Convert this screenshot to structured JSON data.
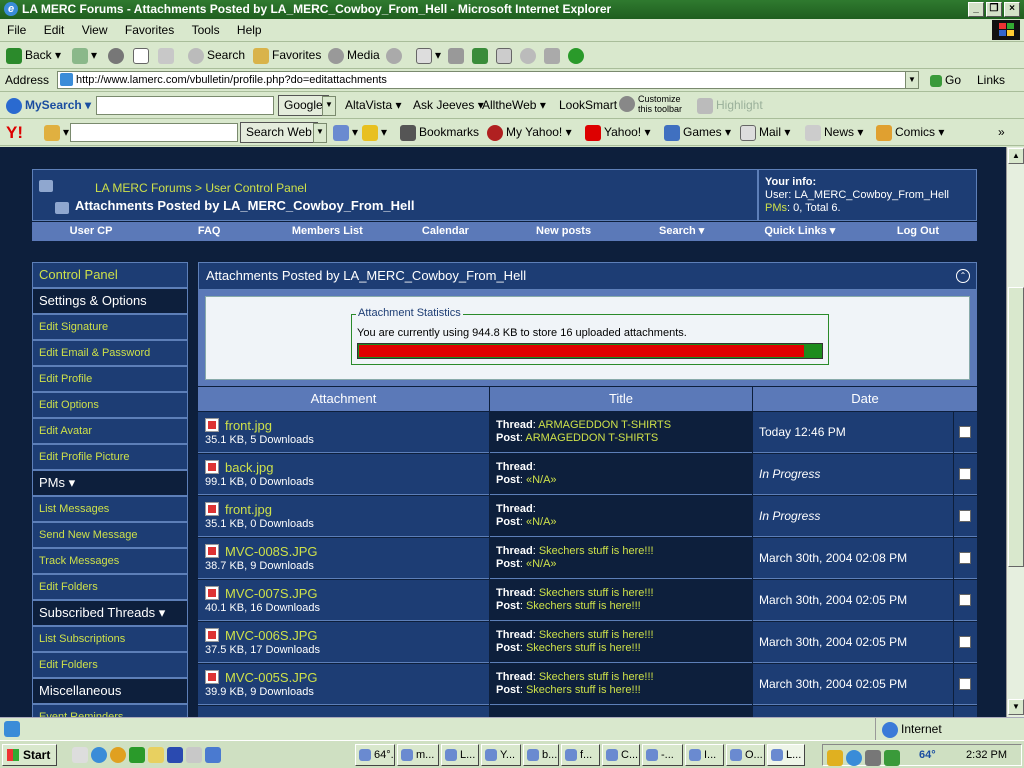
{
  "window": {
    "title": "LA MERC Forums - Attachments Posted by LA_MERC_Cowboy_From_Hell - Microsoft Internet Explorer",
    "controls": [
      "_",
      "❐",
      "×"
    ]
  },
  "menu": [
    "File",
    "Edit",
    "View",
    "Favorites",
    "Tools",
    "Help"
  ],
  "toolbar": {
    "back": "Back",
    "search": "Search",
    "favorites": "Favorites",
    "media": "Media"
  },
  "address": {
    "label": "Address",
    "url": "http://www.lamerc.com/vbulletin/profile.php?do=editattachments",
    "go": "Go",
    "links": "Links"
  },
  "mysearch": {
    "brand": "MySearch",
    "items": [
      "Google",
      "AltaVista",
      "Ask Jeeves",
      "AlltheWeb",
      "LookSmart"
    ],
    "customize_line1": "Customize",
    "customize_line2": "this toolbar",
    "highlight": "Highlight"
  },
  "yahoo": {
    "logo": "Y!",
    "search_web": "Search Web",
    "items": [
      "Bookmarks",
      "My Yahoo!",
      "Yahoo!",
      "Games",
      "Mail",
      "News",
      "Comics"
    ]
  },
  "forum": {
    "breadcrumb_site": "LA MERC Forums",
    "breadcrumb_sep": ">",
    "breadcrumb_page": "User Control Panel",
    "title": "Attachments Posted by LA_MERC_Cowboy_From_Hell",
    "yourinfo_title": "Your info:",
    "yourinfo_user": "User: LA_MERC_Cowboy_From_Hell",
    "yourinfo_pms_label": "PMs",
    "yourinfo_pms_value": ": 0, Total 6.",
    "nav": [
      "User CP",
      "FAQ",
      "Members List",
      "Calendar",
      "New posts",
      "Search ▾",
      "Quick Links ▾",
      "Log Out"
    ]
  },
  "sidebar": [
    {
      "label": "Control Panel",
      "kind": "cp"
    },
    {
      "label": "Settings & Options",
      "kind": "sec"
    },
    {
      "label": "Edit Signature",
      "kind": "it"
    },
    {
      "label": "Edit Email & Password",
      "kind": "it"
    },
    {
      "label": "Edit Profile",
      "kind": "it"
    },
    {
      "label": "Edit Options",
      "kind": "it"
    },
    {
      "label": "Edit Avatar",
      "kind": "it"
    },
    {
      "label": "Edit Profile Picture",
      "kind": "it"
    },
    {
      "label": "PMs ▾",
      "kind": "sec"
    },
    {
      "label": "List Messages",
      "kind": "it"
    },
    {
      "label": "Send New Message",
      "kind": "it"
    },
    {
      "label": "Track Messages",
      "kind": "it"
    },
    {
      "label": "Edit Folders",
      "kind": "it"
    },
    {
      "label": "Subscribed Threads ▾",
      "kind": "sec"
    },
    {
      "label": "List Subscriptions",
      "kind": "it"
    },
    {
      "label": "Edit Folders",
      "kind": "it"
    },
    {
      "label": "Miscellaneous",
      "kind": "sec"
    },
    {
      "label": "Event Reminders",
      "kind": "it"
    }
  ],
  "main": {
    "header": "Attachments Posted by LA_MERC_Cowboy_From_Hell",
    "stats_legend": "Attachment Statistics",
    "stats_text": "You are currently using 944.8 KB to store 16 uploaded attachments.",
    "usage_fraction": 0.96,
    "columns": [
      "Attachment",
      "Title",
      "Date"
    ],
    "thread_label": "Thread",
    "post_label": "Post",
    "rows": [
      {
        "file": "front.jpg",
        "meta": "35.1 KB, 5 Downloads",
        "thread": "ARMAGEDDON T-SHIRTS",
        "post": "ARMAGEDDON T-SHIRTS",
        "date": "Today 12:46 PM"
      },
      {
        "file": "back.jpg",
        "meta": "99.1 KB, 0 Downloads",
        "thread": "",
        "post": "«N/A»",
        "date": "In Progress"
      },
      {
        "file": "front.jpg",
        "meta": "35.1 KB, 0 Downloads",
        "thread": "",
        "post": "«N/A»",
        "date": "In Progress"
      },
      {
        "file": "MVC-008S.JPG",
        "meta": "38.7 KB, 9 Downloads",
        "thread": "Skechers stuff is here!!!",
        "post": "«N/A»",
        "date": "March 30th, 2004 02:08 PM"
      },
      {
        "file": "MVC-007S.JPG",
        "meta": "40.1 KB, 16 Downloads",
        "thread": "Skechers stuff is here!!!",
        "post": "Skechers stuff is here!!!",
        "date": "March 30th, 2004 02:05 PM"
      },
      {
        "file": "MVC-006S.JPG",
        "meta": "37.5 KB, 17 Downloads",
        "thread": "Skechers stuff is here!!!",
        "post": "Skechers stuff is here!!!",
        "date": "March 30th, 2004 02:05 PM"
      },
      {
        "file": "MVC-005S.JPG",
        "meta": "39.9 KB, 9 Downloads",
        "thread": "Skechers stuff is here!!!",
        "post": "Skechers stuff is here!!!",
        "date": "March 30th, 2004 02:05 PM"
      }
    ]
  },
  "statusbar": {
    "zone": "Internet"
  },
  "taskbar": {
    "start": "Start",
    "buttons": [
      "64°...",
      "m...",
      "L...",
      "Y...",
      "b...",
      "f...",
      "C...",
      "-...",
      "I...",
      "O...",
      "L..."
    ],
    "temp": "64°",
    "clock": "2:32 PM"
  }
}
